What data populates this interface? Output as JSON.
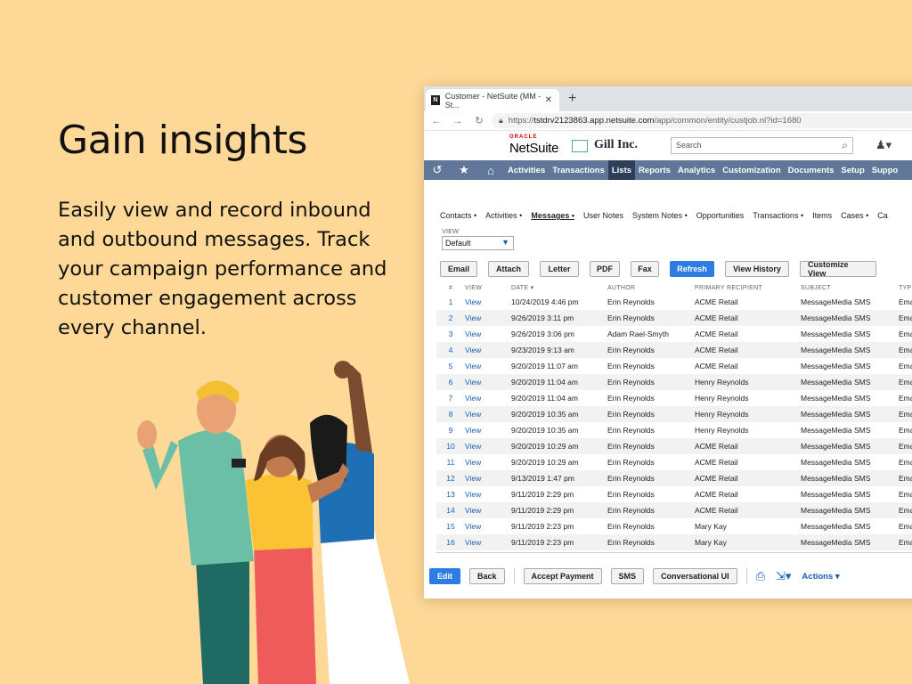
{
  "hero": {
    "title": "Gain insights",
    "body": "Easily view and record inbound and outbound messages. Track your campaign performance and customer engagement across every channel."
  },
  "browser": {
    "tab_title": "Customer - NetSuite (MM - St...",
    "tab_favicon": "N",
    "url_prefix": "https://",
    "url_host": "tstdrv2123863.app.netsuite.com",
    "url_path": "/app/common/entity/custjob.nl?id=1680"
  },
  "netsuite": {
    "oracle": "ORACLE",
    "brand": "NetSuite",
    "company": "Gill Inc.",
    "search_placeholder": "Search"
  },
  "menu": [
    "Activities",
    "Transactions",
    "Lists",
    "Reports",
    "Analytics",
    "Customization",
    "Documents",
    "Setup",
    "Suppo"
  ],
  "menu_selected": "Lists",
  "subtabs": [
    "Contacts •",
    "Activities •",
    "Messages •",
    "User Notes",
    "System Notes •",
    "Opportunities",
    "Transactions •",
    "Items",
    "Cases •",
    "Ca"
  ],
  "subtab_active": "Messages •",
  "view": {
    "label": "VIEW",
    "value": "Default"
  },
  "buttons": [
    "Email",
    "Attach",
    "Letter",
    "PDF",
    "Fax",
    "Refresh",
    "View History",
    "Customize View"
  ],
  "button_primary": "Refresh",
  "columns": [
    "#",
    "VIEW",
    "DATE ▾",
    "AUTHOR",
    "PRIMARY RECIPIENT",
    "SUBJECT",
    "TYP"
  ],
  "rows": [
    [
      "1",
      "View",
      "10/24/2019 4:46 pm",
      "Erin Reynolds",
      "ACME Retail",
      "MessageMedia SMS",
      "Emai"
    ],
    [
      "2",
      "View",
      "9/26/2019 3:11 pm",
      "Erin Reynolds",
      "ACME Retail",
      "MessageMedia SMS",
      "Emai"
    ],
    [
      "3",
      "View",
      "9/26/2019 3:06 pm",
      "Adam Rael-Smyth",
      "ACME Retail",
      "MessageMedia SMS",
      "Emai"
    ],
    [
      "4",
      "View",
      "9/23/2019 9:13 am",
      "Erin Reynolds",
      "ACME Retail",
      "MessageMedia SMS",
      "Emai"
    ],
    [
      "5",
      "View",
      "9/20/2019 11:07 am",
      "Erin Reynolds",
      "ACME Retail",
      "MessageMedia SMS",
      "Emai"
    ],
    [
      "6",
      "View",
      "9/20/2019 11:04 am",
      "Erin Reynolds",
      "Henry Reynolds",
      "MessageMedia SMS",
      "Emai"
    ],
    [
      "7",
      "View",
      "9/20/2019 11:04 am",
      "Erin Reynolds",
      "Henry Reynolds",
      "MessageMedia SMS",
      "Emai"
    ],
    [
      "8",
      "View",
      "9/20/2019 10:35 am",
      "Erin Reynolds",
      "Henry Reynolds",
      "MessageMedia SMS",
      "Emai"
    ],
    [
      "9",
      "View",
      "9/20/2019 10:35 am",
      "Erin Reynolds",
      "Henry Reynolds",
      "MessageMedia SMS",
      "Emai"
    ],
    [
      "10",
      "View",
      "9/20/2019 10:29 am",
      "Erin Reynolds",
      "ACME Retail",
      "MessageMedia SMS",
      "Emai"
    ],
    [
      "11",
      "View",
      "9/20/2019 10:29 am",
      "Erin Reynolds",
      "ACME Retail",
      "MessageMedia SMS",
      "Emai"
    ],
    [
      "12",
      "View",
      "9/13/2019 1:47 pm",
      "Erin Reynolds",
      "ACME Retail",
      "MessageMedia SMS",
      "Emai"
    ],
    [
      "13",
      "View",
      "9/11/2019 2:29 pm",
      "Erin Reynolds",
      "ACME Retail",
      "MessageMedia SMS",
      "Emai"
    ],
    [
      "14",
      "View",
      "9/11/2019 2:29 pm",
      "Erin Reynolds",
      "ACME Retail",
      "MessageMedia SMS",
      "Emai"
    ],
    [
      "15",
      "View",
      "9/11/2019 2:23 pm",
      "Erin Reynolds",
      "Mary Kay",
      "MessageMedia SMS",
      "Emai"
    ],
    [
      "16",
      "View",
      "9/11/2019 2:23 pm",
      "Erin Reynolds",
      "Mary Kay",
      "MessageMedia SMS",
      "Emai"
    ]
  ],
  "footer": {
    "edit": "Edit",
    "back": "Back",
    "accept_payment": "Accept Payment",
    "sms": "SMS",
    "conversational_ui": "Conversational UI",
    "actions": "Actions ▾"
  },
  "colors": {
    "background": "#fdd896",
    "menubar": "#607799",
    "menu_selected": "#2e3e58",
    "primary_button": "#2c7ce4",
    "link": "#1a5fb4"
  }
}
